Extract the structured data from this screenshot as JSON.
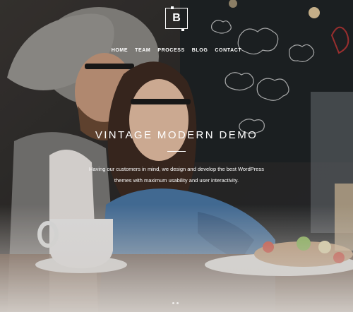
{
  "brand": {
    "logo_letter": "B"
  },
  "nav": {
    "items": [
      "HOME",
      "TEAM",
      "PROCESS",
      "BLOG",
      "CONTACT"
    ]
  },
  "hero": {
    "title": "VINTAGE MODERN DEMO",
    "description": "Having our customers in mind, we design and develop the best WordPress themes with maximum usability and user interactivity."
  },
  "colors": {
    "text": "#ffffff",
    "overlay": "#f2ece6"
  },
  "slider": {
    "dot_count": 2
  }
}
